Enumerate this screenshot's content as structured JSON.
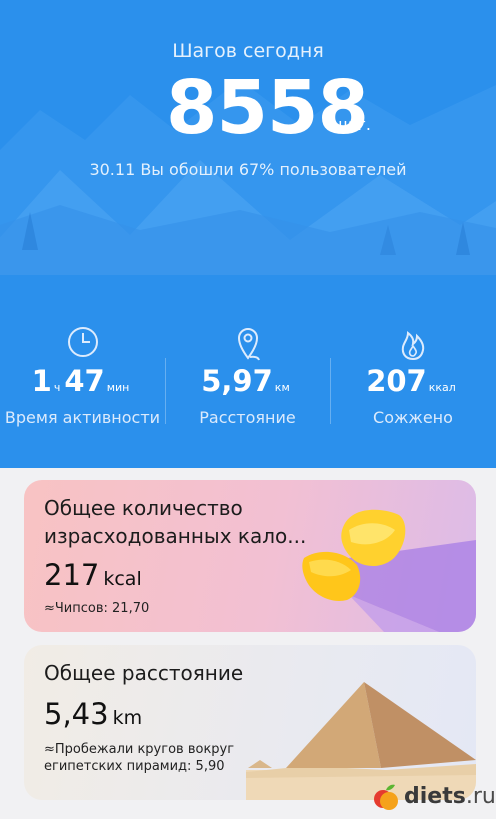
{
  "hero": {
    "title": "Шагов сегодня",
    "steps": "8558",
    "steps_unit": "шаг.",
    "comparison": "30.11 Вы обошли 67% пользователей"
  },
  "stats": {
    "activity": {
      "icon": "clock-icon",
      "hours": "1",
      "hours_unit": "ч",
      "minutes": "47",
      "minutes_unit": "мин",
      "label": "Время активности"
    },
    "distance": {
      "icon": "map-pin-icon",
      "value": "5,97",
      "unit": "км",
      "label": "Расстояние"
    },
    "calories": {
      "icon": "flame-icon",
      "value": "207",
      "unit": "ккал",
      "label": "Сожжено"
    }
  },
  "cards": {
    "calories": {
      "title": "Общее количество израсходованных кало...",
      "value": "217",
      "unit": "kcal",
      "subtitle": "≈Чипсов: 21,70",
      "art": "chips-icon"
    },
    "distance": {
      "title": "Общее расстояние",
      "value": "5,43",
      "unit": "km",
      "subtitle": "≈Пробежали кругов вокруг египетских пирамид: 5,90",
      "art": "pyramid-icon"
    }
  },
  "watermark": {
    "name": "diets",
    "tld": ".ru",
    "logo": "fruit-logo"
  },
  "colors": {
    "hero_blue": "#2b90ec",
    "card_calories": "#f5c1c8",
    "card_distance": "#ece9ea"
  }
}
